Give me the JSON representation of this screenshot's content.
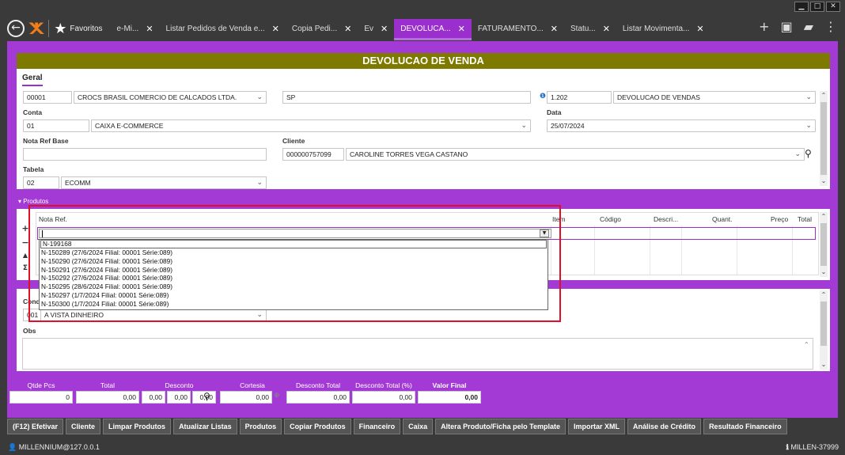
{
  "window": {
    "minimize": "▁",
    "maximize": "□",
    "close": "✕"
  },
  "nav": {
    "back_icon": "←",
    "favorites_label": "Favoritos"
  },
  "tabs": [
    {
      "label": "e-Mi...",
      "active": false
    },
    {
      "label": "Listar Pedidos de Venda e...",
      "active": false
    },
    {
      "label": "Copia Pedi...",
      "active": false
    },
    {
      "label": "Ev",
      "active": false
    },
    {
      "label": "DEVOLUCA...",
      "active": true
    },
    {
      "label": "FATURAMENTO...",
      "active": false
    },
    {
      "label": "Statu...",
      "active": false
    },
    {
      "label": "Listar Movimenta...",
      "active": false
    }
  ],
  "form": {
    "title": "DEVOLUCAO DE VENDA",
    "general_tab": "Geral",
    "empresa_code": "00001",
    "empresa_name": "CROCS BRASIL COMERCIO DE CALCADOS LTDA.",
    "uf": "SP",
    "cfop_code": "1.202",
    "cfop_name": "DEVOLUCAO DE VENDAS",
    "conta_label": "Conta",
    "conta_code": "01",
    "conta_name": "CAIXA E-COMMERCE",
    "data_label": "Data",
    "data_value": "25/07/2024",
    "nota_ref_base_label": "Nota Ref Base",
    "nota_ref_base_value": "",
    "cliente_label": "Cliente",
    "cliente_code": "000000757099",
    "cliente_name": "CAROLINE TORRES VEGA CASTANO",
    "tabela_label": "Tabela",
    "tabela_code": "02",
    "tabela_name": "ECOMM"
  },
  "produtos": {
    "section_label": "Produtos",
    "columns": {
      "nota_ref": "Nota Ref.",
      "item": "Item",
      "codigo": "Código",
      "descricao": "Descri...",
      "quant": "Quant.",
      "preco": "Preço",
      "total": "Total"
    },
    "side_add": "+",
    "side_remove": "−",
    "side_up": "▲",
    "side_sum": "Σ",
    "nota_ref_input": "",
    "dropdown_options": [
      "N-199168",
      "N-150289 (27/6/2024 Filial: 00001 Série:089)",
      "N-150290 (27/6/2024 Filial: 00001 Série:089)",
      "N-150291 (27/6/2024 Filial: 00001 Série:089)",
      "N-150292 (27/6/2024 Filial: 00001 Série:089)",
      "N-150295 (28/6/2024 Filial: 00001 Série:089)",
      "N-150297 (1/7/2024 Filial: 00001 Série:089)",
      "N-150300 (1/7/2024 Filial: 00001 Série:089)"
    ]
  },
  "condicao": {
    "label": "Cond",
    "code": "001",
    "name": "A VISTA DINHEIRO",
    "obs_label": "Obs",
    "obs_value": ""
  },
  "totals": {
    "qtde_pcs_label": "Qtde Pcs",
    "qtde_pcs": "0",
    "total_label": "Total",
    "total": "0,00",
    "desconto_label": "Desconto",
    "desconto_a": "0,00",
    "desconto_b": "0,00",
    "desconto_c": "0,00",
    "cortesia_label": "Cortesia",
    "cortesia": "0,00",
    "desconto_total_label": "Desconto Total",
    "desconto_total": "0,00",
    "desconto_total_pct_label": "Desconto Total (%)",
    "desconto_total_pct": "0,00",
    "valor_final_label": "Valor Final",
    "valor_final": "0,00"
  },
  "actions": [
    "(F12) Efetivar",
    "Cliente",
    "Limpar Produtos",
    "Atualizar Listas",
    "Produtos",
    "Copiar Produtos",
    "Financeiro",
    "Caixa",
    "Altera Produto/Ficha pelo Template",
    "Importar XML",
    "Análise de Crédito",
    "Resultado Financeiro"
  ],
  "status": {
    "left": "MILLENNIUM@127.0.0.1",
    "right": "MILLEN-37999"
  },
  "colors": {
    "accent": "#a43ad6",
    "header": "#7e7a00",
    "highlight": "#e0102a"
  }
}
